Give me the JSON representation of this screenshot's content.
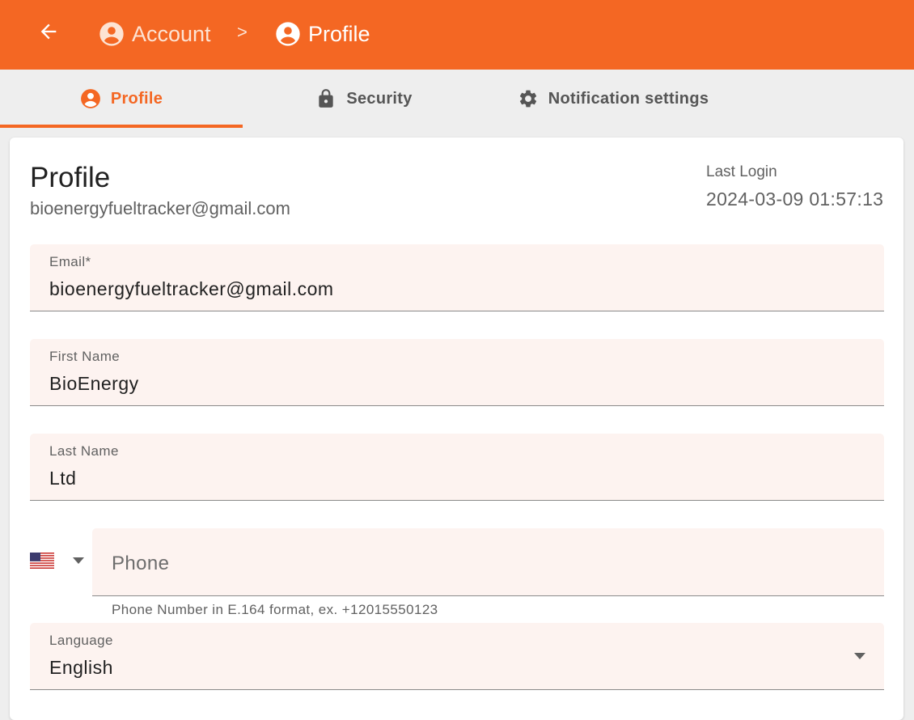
{
  "breadcrumb": {
    "account_label": "Account",
    "separator": ">",
    "current_label": "Profile"
  },
  "tabs": [
    {
      "label": "Profile",
      "icon": "account-circle-icon",
      "active": true
    },
    {
      "label": "Security",
      "icon": "lock-icon",
      "active": false
    },
    {
      "label": "Notification settings",
      "icon": "gear-icon",
      "active": false
    }
  ],
  "profile": {
    "title": "Profile",
    "email": "bioenergyfueltracker@gmail.com",
    "last_login_label": "Last Login",
    "last_login_value": "2024-03-09 01:57:13"
  },
  "form": {
    "email": {
      "label": "Email*",
      "value": "bioenergyfueltracker@gmail.com"
    },
    "first_name": {
      "label": "First Name",
      "value": "BioEnergy"
    },
    "last_name": {
      "label": "Last Name",
      "value": "Ltd"
    },
    "phone": {
      "country_flag": "us-flag-icon",
      "placeholder": "Phone",
      "hint": "Phone Number in E.164 format, ex. +12015550123"
    },
    "language": {
      "label": "Language",
      "value": "English"
    }
  },
  "colors": {
    "accent": "#f46723",
    "field_background": "#fdf3f0",
    "tab_bar_background": "#eeeeee"
  }
}
